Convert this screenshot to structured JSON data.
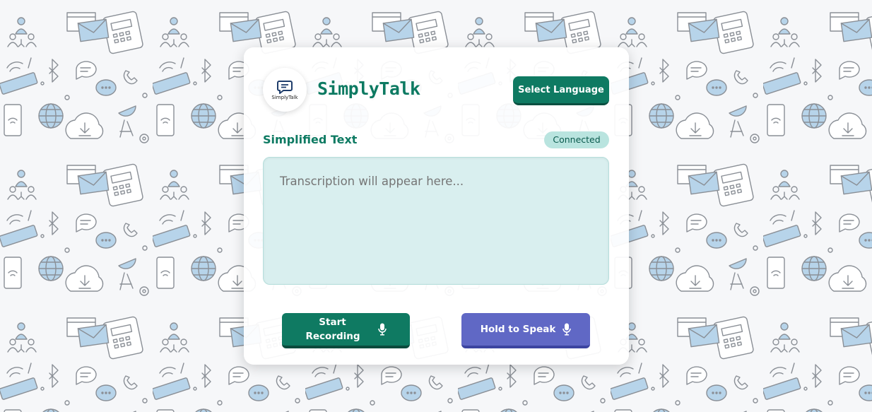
{
  "app": {
    "logo_caption": "SimplyTalk",
    "brand_name": "SimplyTalk"
  },
  "header": {
    "language_button": "Select Language"
  },
  "transcript": {
    "section_title": "Simplified Text",
    "connection_status": "Connected",
    "placeholder": "Transcription will appear here..."
  },
  "controls": {
    "start_recording": "Start Recording",
    "hold_to_speak": "Hold to Speak"
  },
  "colors": {
    "primary": "#0f7a62",
    "accent": "#6068c5",
    "status_bg": "#b9e4df",
    "transcript_bg": "#d9efef",
    "pattern_fill": "#b7d4ea",
    "pattern_stroke": "#8a8f96"
  },
  "icons": [
    "chat-bubble-icon",
    "microphone-icon"
  ]
}
